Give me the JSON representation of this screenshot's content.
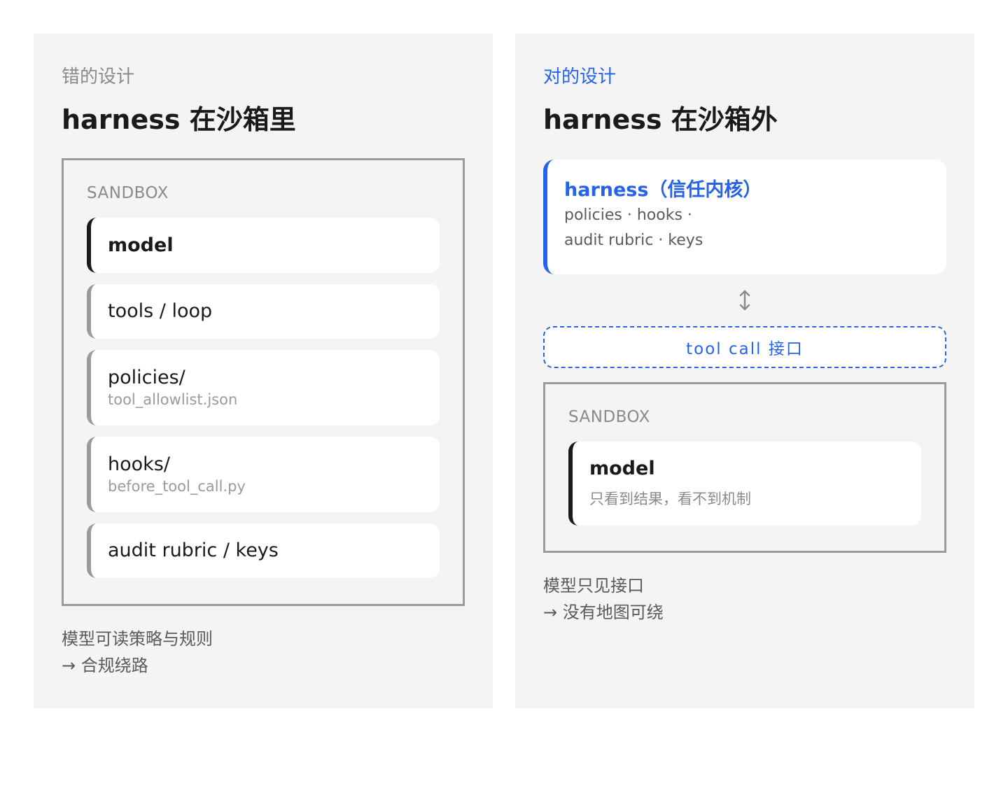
{
  "left": {
    "eyebrow": "错的设计",
    "headline": "harness 在沙箱里",
    "sandbox_label": "SANDBOX",
    "cards": [
      {
        "title": "model"
      },
      {
        "title": "tools / loop"
      },
      {
        "title": "policies/",
        "sub": "tool_allowlist.json"
      },
      {
        "title": "hooks/",
        "sub": "before_tool_call.py"
      },
      {
        "title": "audit rubric / keys"
      }
    ],
    "caption_line1": "模型可读策略与规则",
    "caption_line2": "→ 合规绕路"
  },
  "right": {
    "eyebrow": "对的设计",
    "headline": "harness 在沙箱外",
    "kernel": {
      "title": "harness（信任内核）",
      "line1": "policies · hooks ·",
      "line2": "audit rubric · keys"
    },
    "arrow_icon": "up-down-arrow-icon",
    "interface_label": "tool call 接口",
    "sandbox_label": "SANDBOX",
    "model": {
      "title": "model",
      "sub": "只看到结果，看不到机制"
    },
    "caption_line1": "模型只见接口",
    "caption_line2": "→ 没有地图可绕"
  },
  "colors": {
    "accent": "#2563eb",
    "panel_bg": "#f4f4f4",
    "border_gray": "#9a9a9a",
    "dark": "#1a1a1a"
  }
}
